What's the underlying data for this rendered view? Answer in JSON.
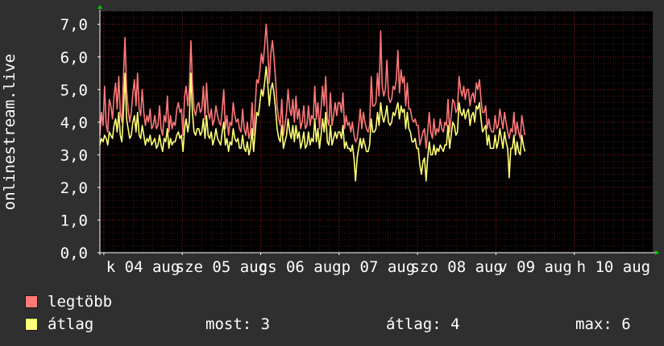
{
  "chart_data": {
    "type": "line",
    "ylabel": "onlinestream.live",
    "ylim": [
      0,
      7.4
    ],
    "y_ticks": [
      "0,0",
      "1,0",
      "2,0",
      "3,0",
      "4,0",
      "5,0",
      "6,0",
      "7,0"
    ],
    "x_ticks": [
      "k 04 aug",
      "sze 05 aug",
      "cs 06 aug",
      "p 07 aug",
      "szo 08 aug",
      "v 09 aug",
      "h 10 aug"
    ],
    "x_tick_positions_days": [
      0,
      1,
      2,
      3,
      4,
      5,
      6
    ],
    "xlim_days": [
      -0.05,
      7.0
    ],
    "grid": true,
    "colors": {
      "background": "#000000",
      "grid_major": "#8b1e1e",
      "grid_minor": "#3c1a1a",
      "axis": "#ffffff",
      "arrow": "#00cc00"
    },
    "series": [
      {
        "name": "legtöbb",
        "color": "#ff7878",
        "x_start_day": -0.05,
        "x_step_day": 0.02,
        "values": [
          3.6,
          4.3,
          3.9,
          5.1,
          3.9,
          3.7,
          4.7,
          4.5,
          4.1,
          4.8,
          5.2,
          4.4,
          5.4,
          4.3,
          4.0,
          5.4,
          6.6,
          5.0,
          4.4,
          4.0,
          4.3,
          4.9,
          5.3,
          4.5,
          5.5,
          4.4,
          4.2,
          5.0,
          4.3,
          3.9,
          4.2,
          4.0,
          4.4,
          3.8,
          3.9,
          4.2,
          3.8,
          3.9,
          4.5,
          3.8,
          3.6,
          4.2,
          4.0,
          4.8,
          3.7,
          4.2,
          3.8,
          4.0,
          3.9,
          4.4,
          4.6,
          4.3,
          4.4,
          3.6,
          4.8,
          5.1,
          4.5,
          5.0,
          6.5,
          5.2,
          4.4,
          4.2,
          4.5,
          4.6,
          4.3,
          4.4,
          5.1,
          4.1,
          5.2,
          4.3,
          4.1,
          4.4,
          3.9,
          4.1,
          4.5,
          4.2,
          4.0,
          3.9,
          4.4,
          5.0,
          3.8,
          4.2,
          3.6,
          4.0,
          3.9,
          4.6,
          4.2,
          4.0,
          4.1,
          3.8,
          3.7,
          4.4,
          3.8,
          3.6,
          4.0,
          3.5,
          3.7,
          4.6,
          3.6,
          4.5,
          5.3,
          5.2,
          5.6,
          6.1,
          5.8,
          6.3,
          7.0,
          6.3,
          5.2,
          6.1,
          6.5,
          6.0,
          5.3,
          4.5,
          4.1,
          3.9,
          4.7,
          3.6,
          3.9,
          4.3,
          5.0,
          4.4,
          4.2,
          4.7,
          4.0,
          4.8,
          4.1,
          4.4,
          3.8,
          4.0,
          4.5,
          3.8,
          3.9,
          4.5,
          3.9,
          4.2,
          4.1,
          5.1,
          4.1,
          4.6,
          3.8,
          4.4,
          5.1,
          4.5,
          5.4,
          4.1,
          3.9,
          4.9,
          3.9,
          4.2,
          4.6,
          4.2,
          4.6,
          4.6,
          4.3,
          4.9,
          3.8,
          4.2,
          3.9,
          4.0,
          3.7,
          4.0,
          3.6,
          3.4,
          3.5,
          3.9,
          4.4,
          3.8,
          4.3,
          4.0,
          3.8,
          3.7,
          3.9,
          5.4,
          4.5,
          4.5,
          4.6,
          5.5,
          4.8,
          6.8,
          5.1,
          4.8,
          5.0,
          5.9,
          4.8,
          4.6,
          4.7,
          5.1,
          5.0,
          5.3,
          6.2,
          4.9,
          5.6,
          5.2,
          5.4,
          4.5,
          5.2,
          4.4,
          4.4,
          4.1,
          4.0,
          4.1,
          3.9,
          3.9,
          3.3,
          3.5,
          3.7,
          3.8,
          3.2,
          3.7,
          4.3,
          3.7,
          3.5,
          4.1,
          3.6,
          3.8,
          3.7,
          4.1,
          3.8,
          3.7,
          4.0,
          3.9,
          4.7,
          3.7,
          4.2,
          4.7,
          4.6,
          4.3,
          4.4,
          5.4,
          5.0,
          4.8,
          5.1,
          4.7,
          5.0,
          5.0,
          4.5,
          4.8,
          4.9,
          4.6,
          5.2,
          5.0,
          5.3,
          4.7,
          4.3,
          4.3,
          4.5,
          3.8,
          4.1,
          3.8,
          3.7,
          3.7,
          4.2,
          3.8,
          3.9,
          4.4,
          4.1,
          3.8,
          4.3,
          4.0,
          3.7,
          3.5,
          3.8,
          3.7,
          4.3,
          3.6,
          4.0,
          3.7,
          3.5,
          4.2,
          3.9,
          3.6
        ],
        "values_note_coverage": "plotted across the chart from left edge to right edge"
      },
      {
        "name": "átlag",
        "color": "#ffff78",
        "x_start_day": -0.05,
        "x_step_day": 0.02,
        "values": [
          3.3,
          3.5,
          3.4,
          3.6,
          3.5,
          3.3,
          3.7,
          3.6,
          3.5,
          3.9,
          4.1,
          3.7,
          4.3,
          3.6,
          3.4,
          4.3,
          5.5,
          4.1,
          3.8,
          3.5,
          3.6,
          4.0,
          4.2,
          3.7,
          4.3,
          3.6,
          3.5,
          3.9,
          3.6,
          3.3,
          3.5,
          3.4,
          3.6,
          3.3,
          3.4,
          3.5,
          3.2,
          3.3,
          3.6,
          3.3,
          3.1,
          3.5,
          3.4,
          3.8,
          3.2,
          3.5,
          3.3,
          3.4,
          3.4,
          3.6,
          3.7,
          3.5,
          3.6,
          3.1,
          3.8,
          4.1,
          3.7,
          4.0,
          5.5,
          4.3,
          3.7,
          3.6,
          3.8,
          3.8,
          3.6,
          3.7,
          4.1,
          3.5,
          4.2,
          3.6,
          3.5,
          3.7,
          3.3,
          3.5,
          3.8,
          3.5,
          3.4,
          3.3,
          3.7,
          4.0,
          3.3,
          3.5,
          3.1,
          3.4,
          3.3,
          3.8,
          3.5,
          3.4,
          3.5,
          3.2,
          3.2,
          3.6,
          3.2,
          3.1,
          3.4,
          3.0,
          3.2,
          3.8,
          3.1,
          3.7,
          4.3,
          4.2,
          4.6,
          5.0,
          4.8,
          5.2,
          5.7,
          5.2,
          4.5,
          5.0,
          5.2,
          4.9,
          4.4,
          3.8,
          3.5,
          3.4,
          3.9,
          3.2,
          3.4,
          3.6,
          4.1,
          3.7,
          3.5,
          3.9,
          3.4,
          3.9,
          3.5,
          3.7,
          3.2,
          3.4,
          3.7,
          3.2,
          3.3,
          3.7,
          3.3,
          3.5,
          3.4,
          4.1,
          3.4,
          3.8,
          3.2,
          3.6,
          4.1,
          3.7,
          4.3,
          3.4,
          3.3,
          3.9,
          3.3,
          3.5,
          3.7,
          3.5,
          3.7,
          3.7,
          3.5,
          3.9,
          3.2,
          3.4,
          3.2,
          3.2,
          3.1,
          3.3,
          2.9,
          2.2,
          2.9,
          3.2,
          3.5,
          3.2,
          3.5,
          3.3,
          3.1,
          3.1,
          3.3,
          4.1,
          3.7,
          3.7,
          3.8,
          4.3,
          3.9,
          4.6,
          4.2,
          4.0,
          4.2,
          4.5,
          4.0,
          3.9,
          4.0,
          4.3,
          4.2,
          4.4,
          4.6,
          4.1,
          4.5,
          4.3,
          4.4,
          3.8,
          4.3,
          3.8,
          3.7,
          3.4,
          3.4,
          3.5,
          3.2,
          3.2,
          2.7,
          2.4,
          2.8,
          2.9,
          2.2,
          2.9,
          3.4,
          3.0,
          3.0,
          3.3,
          3.0,
          3.2,
          3.1,
          3.3,
          3.2,
          3.1,
          3.3,
          3.3,
          3.9,
          3.2,
          3.6,
          4.0,
          3.9,
          3.6,
          3.7,
          4.6,
          4.3,
          4.2,
          4.4,
          4.1,
          4.3,
          4.4,
          3.9,
          4.2,
          4.3,
          4.0,
          4.5,
          4.4,
          4.6,
          4.1,
          3.7,
          3.8,
          3.9,
          3.3,
          3.6,
          3.2,
          3.2,
          3.2,
          3.6,
          3.2,
          3.4,
          3.8,
          3.5,
          3.2,
          3.7,
          3.4,
          3.2,
          2.3,
          3.2,
          3.2,
          3.6,
          3.0,
          3.4,
          3.1,
          3.0,
          3.6,
          3.3,
          3.1
        ]
      }
    ]
  },
  "legend": [
    {
      "label": "legtöbb",
      "color": "#ff7878"
    },
    {
      "label": "átlag",
      "color": "#ffff78"
    }
  ],
  "stats": {
    "most": "most: 3",
    "atlag": "átlag: 4",
    "max": "max: 6"
  }
}
